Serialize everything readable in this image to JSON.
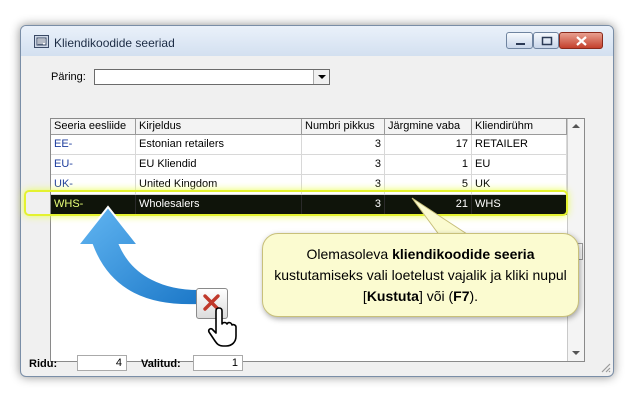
{
  "window": {
    "title": "Kliendikoodide seeriad"
  },
  "query": {
    "label": "Päring:",
    "value": ""
  },
  "table": {
    "columns": [
      "Seeria eesliide",
      "Kirjeldus",
      "Numbri pikkus",
      "Järgmine vaba",
      "Kliendirühm"
    ],
    "rows": [
      {
        "prefix": "EE-",
        "description": "Estonian retailers",
        "length": "3",
        "next": "17",
        "group": "RETAILER",
        "selected": false
      },
      {
        "prefix": "EU-",
        "description": "EU Kliendid",
        "length": "3",
        "next": "1",
        "group": "EU",
        "selected": false
      },
      {
        "prefix": "UK-",
        "description": "United Kingdom",
        "length": "3",
        "next": "5",
        "group": "UK",
        "selected": false
      },
      {
        "prefix": "WHS-",
        "description": "Wholesalers",
        "length": "3",
        "next": "21",
        "group": "WHS",
        "selected": true
      }
    ]
  },
  "status": {
    "rows_label": "Ridu:",
    "rows_value": "4",
    "selected_label": "Valitud:",
    "selected_value": "1"
  },
  "callout": {
    "part1": "Olemasoleva ",
    "bold1": "kliendikoodide seeria",
    "part2": " kustutamiseks vali loetelust vajalik ja kliki nupul [",
    "bold2": "Kustuta",
    "part3": "] või (",
    "bold3": "F7",
    "part4": ")."
  },
  "colors": {
    "selected_row_bg": "#0f140a",
    "highlight": "#e4f230",
    "callout_bg": "#fbfbd0",
    "arrow_blue": "#2a8ee0",
    "delete_x": "#c0392b"
  },
  "icons": {
    "app": "series-app-icon",
    "delete": "delete-x-icon",
    "cursor": "hand-pointer-icon"
  }
}
